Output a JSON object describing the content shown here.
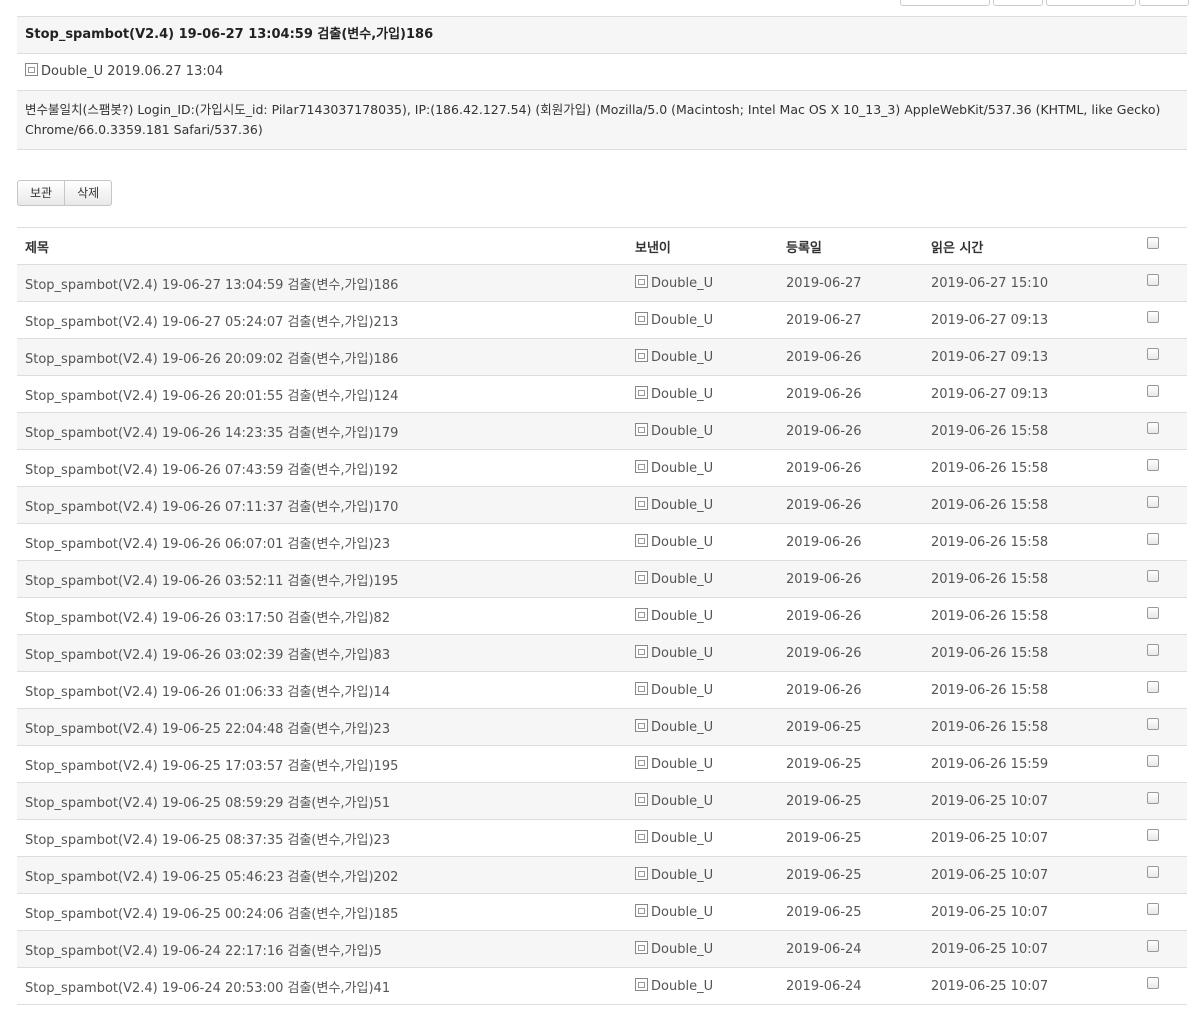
{
  "message": {
    "title": "Stop_spambot(V2.4) 19-06-27 13:04:59 검출(변수,가입)186",
    "sender": "Double_U",
    "datetime": "2019.06.27 13:04",
    "body": "변수불일치(스팸봇?) Login_ID:(가입시도_id: Pilar7143037178035), IP:(186.42.127.54) (회원가입) (Mozilla/5.0 (Macintosh; Intel Mac OS X 10_13_3) AppleWebKit/537.36 (KHTML, like Gecko) Chrome/66.0.3359.181 Safari/537.36)"
  },
  "actions": {
    "archive_label": "보관",
    "delete_label": "삭제"
  },
  "table": {
    "headers": {
      "title": "제목",
      "sender": "보낸이",
      "registered": "등록일",
      "read_time": "읽은 시간"
    },
    "rows": [
      {
        "title": "Stop_spambot(V2.4) 19-06-27 13:04:59 검출(변수,가입)186",
        "sender": "Double_U",
        "registered": "2019-06-27",
        "read_time": "2019-06-27 15:10"
      },
      {
        "title": "Stop_spambot(V2.4) 19-06-27 05:24:07 검출(변수,가입)213",
        "sender": "Double_U",
        "registered": "2019-06-27",
        "read_time": "2019-06-27 09:13"
      },
      {
        "title": "Stop_spambot(V2.4) 19-06-26 20:09:02 검출(변수,가입)186",
        "sender": "Double_U",
        "registered": "2019-06-26",
        "read_time": "2019-06-27 09:13"
      },
      {
        "title": "Stop_spambot(V2.4) 19-06-26 20:01:55 검출(변수,가입)124",
        "sender": "Double_U",
        "registered": "2019-06-26",
        "read_time": "2019-06-27 09:13"
      },
      {
        "title": "Stop_spambot(V2.4) 19-06-26 14:23:35 검출(변수,가입)179",
        "sender": "Double_U",
        "registered": "2019-06-26",
        "read_time": "2019-06-26 15:58"
      },
      {
        "title": "Stop_spambot(V2.4) 19-06-26 07:43:59 검출(변수,가입)192",
        "sender": "Double_U",
        "registered": "2019-06-26",
        "read_time": "2019-06-26 15:58"
      },
      {
        "title": "Stop_spambot(V2.4) 19-06-26 07:11:37 검출(변수,가입)170",
        "sender": "Double_U",
        "registered": "2019-06-26",
        "read_time": "2019-06-26 15:58"
      },
      {
        "title": "Stop_spambot(V2.4) 19-06-26 06:07:01 검출(변수,가입)23",
        "sender": "Double_U",
        "registered": "2019-06-26",
        "read_time": "2019-06-26 15:58"
      },
      {
        "title": "Stop_spambot(V2.4) 19-06-26 03:52:11 검출(변수,가입)195",
        "sender": "Double_U",
        "registered": "2019-06-26",
        "read_time": "2019-06-26 15:58"
      },
      {
        "title": "Stop_spambot(V2.4) 19-06-26 03:17:50 검출(변수,가입)82",
        "sender": "Double_U",
        "registered": "2019-06-26",
        "read_time": "2019-06-26 15:58"
      },
      {
        "title": "Stop_spambot(V2.4) 19-06-26 03:02:39 검출(변수,가입)83",
        "sender": "Double_U",
        "registered": "2019-06-26",
        "read_time": "2019-06-26 15:58"
      },
      {
        "title": "Stop_spambot(V2.4) 19-06-26 01:06:33 검출(변수,가입)14",
        "sender": "Double_U",
        "registered": "2019-06-26",
        "read_time": "2019-06-26 15:58"
      },
      {
        "title": "Stop_spambot(V2.4) 19-06-25 22:04:48 검출(변수,가입)23",
        "sender": "Double_U",
        "registered": "2019-06-25",
        "read_time": "2019-06-26 15:58"
      },
      {
        "title": "Stop_spambot(V2.4) 19-06-25 17:03:57 검출(변수,가입)195",
        "sender": "Double_U",
        "registered": "2019-06-25",
        "read_time": "2019-06-26 15:59"
      },
      {
        "title": "Stop_spambot(V2.4) 19-06-25 08:59:29 검출(변수,가입)51",
        "sender": "Double_U",
        "registered": "2019-06-25",
        "read_time": "2019-06-25 10:07"
      },
      {
        "title": "Stop_spambot(V2.4) 19-06-25 08:37:35 검출(변수,가입)23",
        "sender": "Double_U",
        "registered": "2019-06-25",
        "read_time": "2019-06-25 10:07"
      },
      {
        "title": "Stop_spambot(V2.4) 19-06-25 05:46:23 검출(변수,가입)202",
        "sender": "Double_U",
        "registered": "2019-06-25",
        "read_time": "2019-06-25 10:07"
      },
      {
        "title": "Stop_spambot(V2.4) 19-06-25 00:24:06 검출(변수,가입)185",
        "sender": "Double_U",
        "registered": "2019-06-25",
        "read_time": "2019-06-25 10:07"
      },
      {
        "title": "Stop_spambot(V2.4) 19-06-24 22:17:16 검출(변수,가입)5",
        "sender": "Double_U",
        "registered": "2019-06-24",
        "read_time": "2019-06-25 10:07"
      },
      {
        "title": "Stop_spambot(V2.4) 19-06-24 20:53:00 검출(변수,가입)41",
        "sender": "Double_U",
        "registered": "2019-06-24",
        "read_time": "2019-06-25 10:07"
      }
    ]
  }
}
